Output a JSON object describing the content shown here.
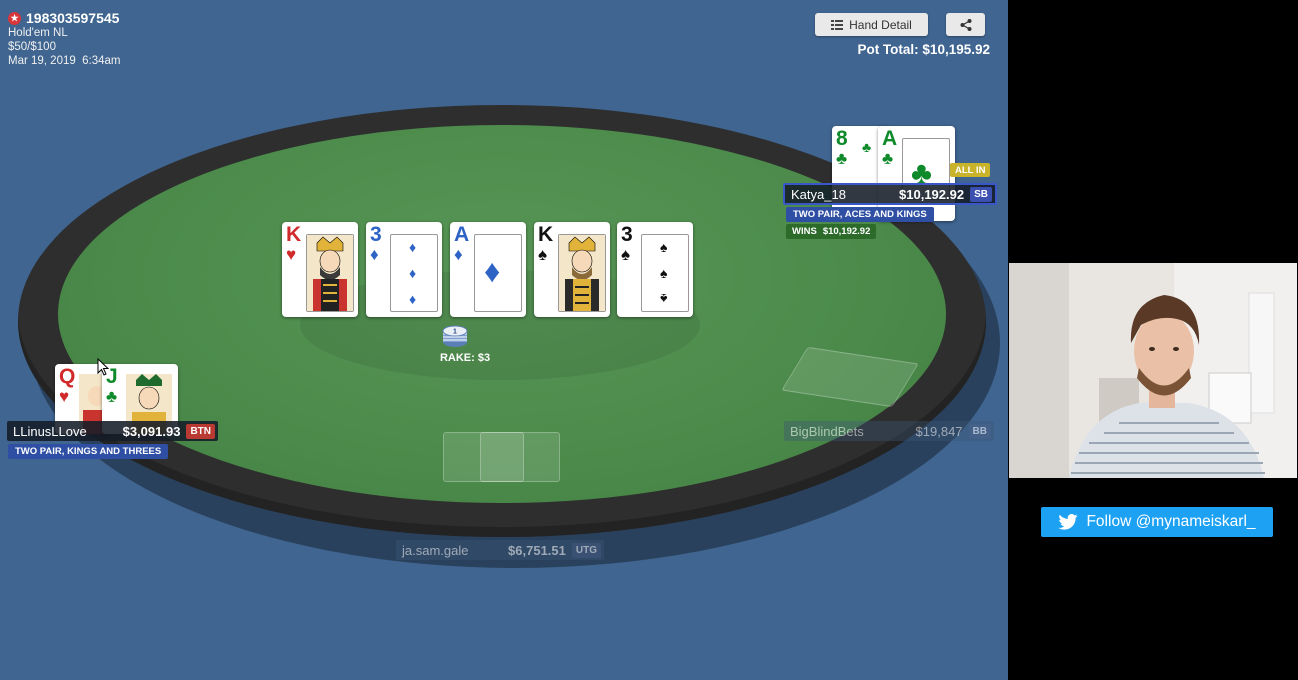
{
  "hand": {
    "id": "198303597545",
    "game": "Hold'em NL",
    "stakes": "$50/$100",
    "datetime": "Mar 19, 2019  6:34am"
  },
  "toolbar": {
    "hand_detail_label": "Hand Detail",
    "hand_detail_icon": "list-icon",
    "share_icon": "share-icon"
  },
  "pot": {
    "label": "Pot Total: $10,195.92"
  },
  "board": {
    "cards": [
      {
        "rank": "K",
        "suit": "hearts",
        "color": "#d02a2a"
      },
      {
        "rank": "3",
        "suit": "diamonds",
        "color": "#2e63c6"
      },
      {
        "rank": "A",
        "suit": "diamonds",
        "color": "#2e63c6"
      },
      {
        "rank": "K",
        "suit": "spades",
        "color": "#111111"
      },
      {
        "rank": "3",
        "suit": "spades",
        "color": "#111111"
      }
    ]
  },
  "rake": {
    "chip_value": "1",
    "label": "RAKE: $3"
  },
  "players": {
    "katya": {
      "name": "Katya_18",
      "stack": "$10,192.92",
      "position": "SB",
      "status": "ALL IN",
      "hand_description": "TWO PAIR, ACES AND KINGS",
      "wins_label": "WINS",
      "wins_amount": "$10,192.92",
      "hole_cards": [
        {
          "rank": "8",
          "suit": "clubs",
          "color": "#0f8a2a"
        },
        {
          "rank": "A",
          "suit": "clubs",
          "color": "#0f8a2a"
        }
      ]
    },
    "linus": {
      "name": "LLinusLLove",
      "stack": "$3,091.93",
      "position": "BTN",
      "hand_description": "TWO PAIR, KINGS AND THREES",
      "hole_cards": [
        {
          "rank": "Q",
          "suit": "hearts",
          "color": "#d02a2a"
        },
        {
          "rank": "J",
          "suit": "clubs",
          "color": "#0f8a2a"
        }
      ]
    },
    "bigblind": {
      "name": "BigBlindBets",
      "stack": "$19,847",
      "position": "BB"
    },
    "jasam": {
      "name": "ja.sam.gale",
      "stack": "$6,751.51",
      "position": "UTG"
    }
  },
  "overlay": {
    "follow_label": "Follow @mynameiskarl_",
    "follow_icon": "twitter-bird-icon"
  },
  "colors": {
    "background": "#3f6590",
    "felt": "#4c8a4b",
    "rail": "#2e2e2e",
    "twitter": "#1da1f2",
    "hand_label": "#2e4fa3",
    "allin": "#c9b32a",
    "btn_badge": "#b83a32",
    "sb_badge": "#3a4fb0"
  }
}
